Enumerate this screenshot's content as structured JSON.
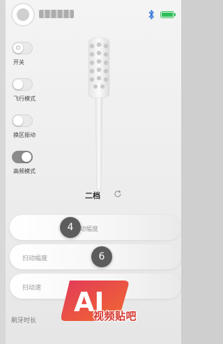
{
  "header": {
    "avatar_icon": "user-avatar",
    "bluetooth_icon": "bluetooth-icon",
    "battery_level": 1.0,
    "battery_color": "#2fbf5a"
  },
  "side_toggles": [
    {
      "label": "开关",
      "state": "off",
      "icon": "power-icon"
    },
    {
      "label": "飞行模式",
      "state": "off"
    },
    {
      "label": "换区振动",
      "state": "off"
    },
    {
      "label": "高频模式",
      "state": "on"
    }
  ],
  "mode": {
    "label": "二档",
    "refresh_icon": "refresh-icon"
  },
  "sliders": [
    {
      "label": "动幅度",
      "value": "4"
    },
    {
      "label": "扫动幅度",
      "value": "6"
    },
    {
      "label": "扫动速"
    }
  ],
  "brush_time_label": "刷牙时长",
  "watermark": {
    "logo_text": "AI",
    "text": "视频贴吧",
    "color": "#d5362e"
  }
}
